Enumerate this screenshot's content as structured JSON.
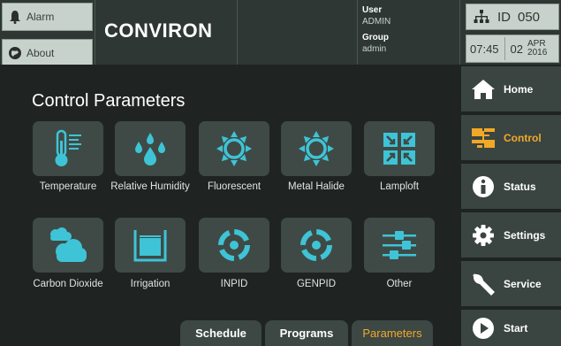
{
  "header": {
    "alarm_label": "Alarm",
    "about_label": "About",
    "logo_text": "CONVIRON",
    "user_label": "User",
    "user_value": "ADMIN",
    "group_label": "Group",
    "group_value": "admin",
    "id_label": "ID",
    "id_value": "050",
    "time": "07:45",
    "day": "02",
    "month": "APR",
    "year": "2016"
  },
  "main": {
    "title": "Control Parameters",
    "tiles": [
      {
        "label": "Temperature",
        "icon": "thermometer-icon"
      },
      {
        "label": "Relative Humidity",
        "icon": "droplets-icon"
      },
      {
        "label": "Fluorescent",
        "icon": "sun-icon"
      },
      {
        "label": "Metal Halide",
        "icon": "sun-icon"
      },
      {
        "label": "Lamploft",
        "icon": "lamploft-grid-icon"
      },
      {
        "label": "Carbon Dioxide",
        "icon": "clouds-icon"
      },
      {
        "label": "Irrigation",
        "icon": "water-container-icon"
      },
      {
        "label": "INPID",
        "icon": "pid-cycle-icon"
      },
      {
        "label": "GENPID",
        "icon": "pid-cycle-icon"
      },
      {
        "label": "Other",
        "icon": "sliders-icon"
      }
    ],
    "tabs": [
      {
        "label": "Schedule"
      },
      {
        "label": "Programs"
      },
      {
        "label": "Parameters",
        "active": true
      }
    ]
  },
  "sidebar": {
    "items": [
      {
        "label": "Home",
        "icon": "home-icon"
      },
      {
        "label": "Control",
        "icon": "control-icon",
        "active": true
      },
      {
        "label": "Status",
        "icon": "info-icon"
      },
      {
        "label": "Settings",
        "icon": "gear-icon"
      },
      {
        "label": "Service",
        "icon": "wrench-icon"
      },
      {
        "label": "Start",
        "icon": "play-icon"
      }
    ]
  },
  "colors": {
    "tile_icon": "#3ec4d6",
    "active": "#f2a827",
    "background": "#1f2422",
    "tile_bg": "#3f4a46"
  }
}
